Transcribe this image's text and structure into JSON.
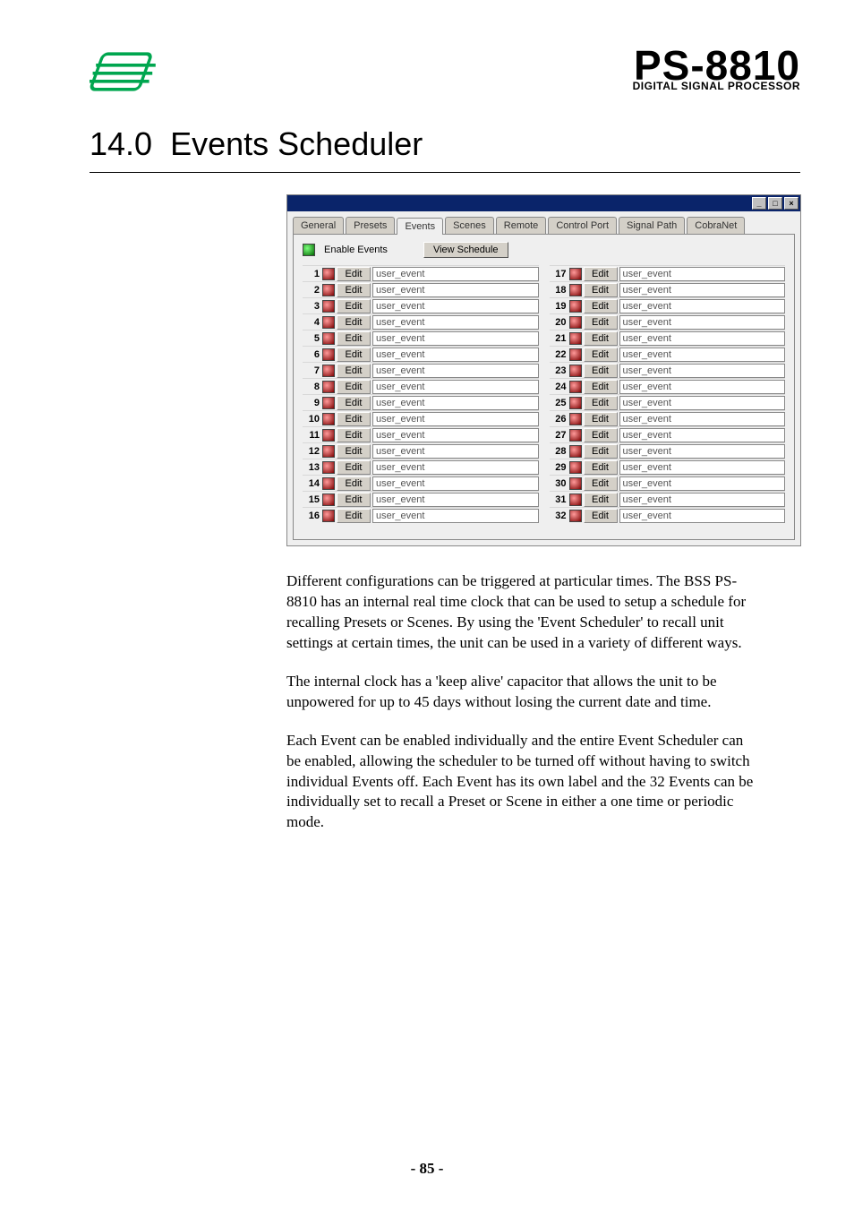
{
  "header": {
    "brand_model": "PS-8810",
    "brand_sub": "DIGITAL SIGNAL PROCESSOR"
  },
  "section": {
    "number": "14.0",
    "title": "Events Scheduler"
  },
  "dialog": {
    "win_min": "_",
    "win_max": "□",
    "win_close": "×",
    "tabs": [
      "General",
      "Presets",
      "Events",
      "Scenes",
      "Remote",
      "Control Port",
      "Signal Path",
      "CobraNet"
    ],
    "active_tab_index": 2,
    "enable_label": "Enable Events",
    "view_schedule_label": "View Schedule",
    "edit_label": "Edit",
    "events_left": [
      {
        "n": "1",
        "label": "user_event"
      },
      {
        "n": "2",
        "label": "user_event"
      },
      {
        "n": "3",
        "label": "user_event"
      },
      {
        "n": "4",
        "label": "user_event"
      },
      {
        "n": "5",
        "label": "user_event"
      },
      {
        "n": "6",
        "label": "user_event"
      },
      {
        "n": "7",
        "label": "user_event"
      },
      {
        "n": "8",
        "label": "user_event"
      },
      {
        "n": "9",
        "label": "user_event"
      },
      {
        "n": "10",
        "label": "user_event"
      },
      {
        "n": "11",
        "label": "user_event"
      },
      {
        "n": "12",
        "label": "user_event"
      },
      {
        "n": "13",
        "label": "user_event"
      },
      {
        "n": "14",
        "label": "user_event"
      },
      {
        "n": "15",
        "label": "user_event"
      },
      {
        "n": "16",
        "label": "user_event"
      }
    ],
    "events_right": [
      {
        "n": "17",
        "label": "user_event"
      },
      {
        "n": "18",
        "label": "user_event"
      },
      {
        "n": "19",
        "label": "user_event"
      },
      {
        "n": "20",
        "label": "user_event"
      },
      {
        "n": "21",
        "label": "user_event"
      },
      {
        "n": "22",
        "label": "user_event"
      },
      {
        "n": "23",
        "label": "user_event"
      },
      {
        "n": "24",
        "label": "user_event"
      },
      {
        "n": "25",
        "label": "user_event"
      },
      {
        "n": "26",
        "label": "user_event"
      },
      {
        "n": "27",
        "label": "user_event"
      },
      {
        "n": "28",
        "label": "user_event"
      },
      {
        "n": "29",
        "label": "user_event"
      },
      {
        "n": "30",
        "label": "user_event"
      },
      {
        "n": "31",
        "label": "user_event"
      },
      {
        "n": "32",
        "label": "user_event"
      }
    ]
  },
  "paragraphs": {
    "p1": "Different configurations can be triggered at particular times.  The BSS PS-8810 has an internal real time clock that can be used to setup a schedule for recalling Presets or Scenes.  By using the 'Event Scheduler' to recall unit settings at certain times, the unit can be used in a variety of different ways.",
    "p2": "The internal clock has a 'keep alive' capacitor that allows the unit to be unpowered for up to 45 days without losing the current date and time.",
    "p3": "Each Event can be enabled individually and the entire Event Scheduler can be enabled, allowing the scheduler to be turned off without having to switch individual Events off.  Each Event has its own label and the 32 Events can be individually set to recall a Preset or Scene in either a one time or periodic mode."
  },
  "footer": {
    "page": "- 85 -"
  }
}
